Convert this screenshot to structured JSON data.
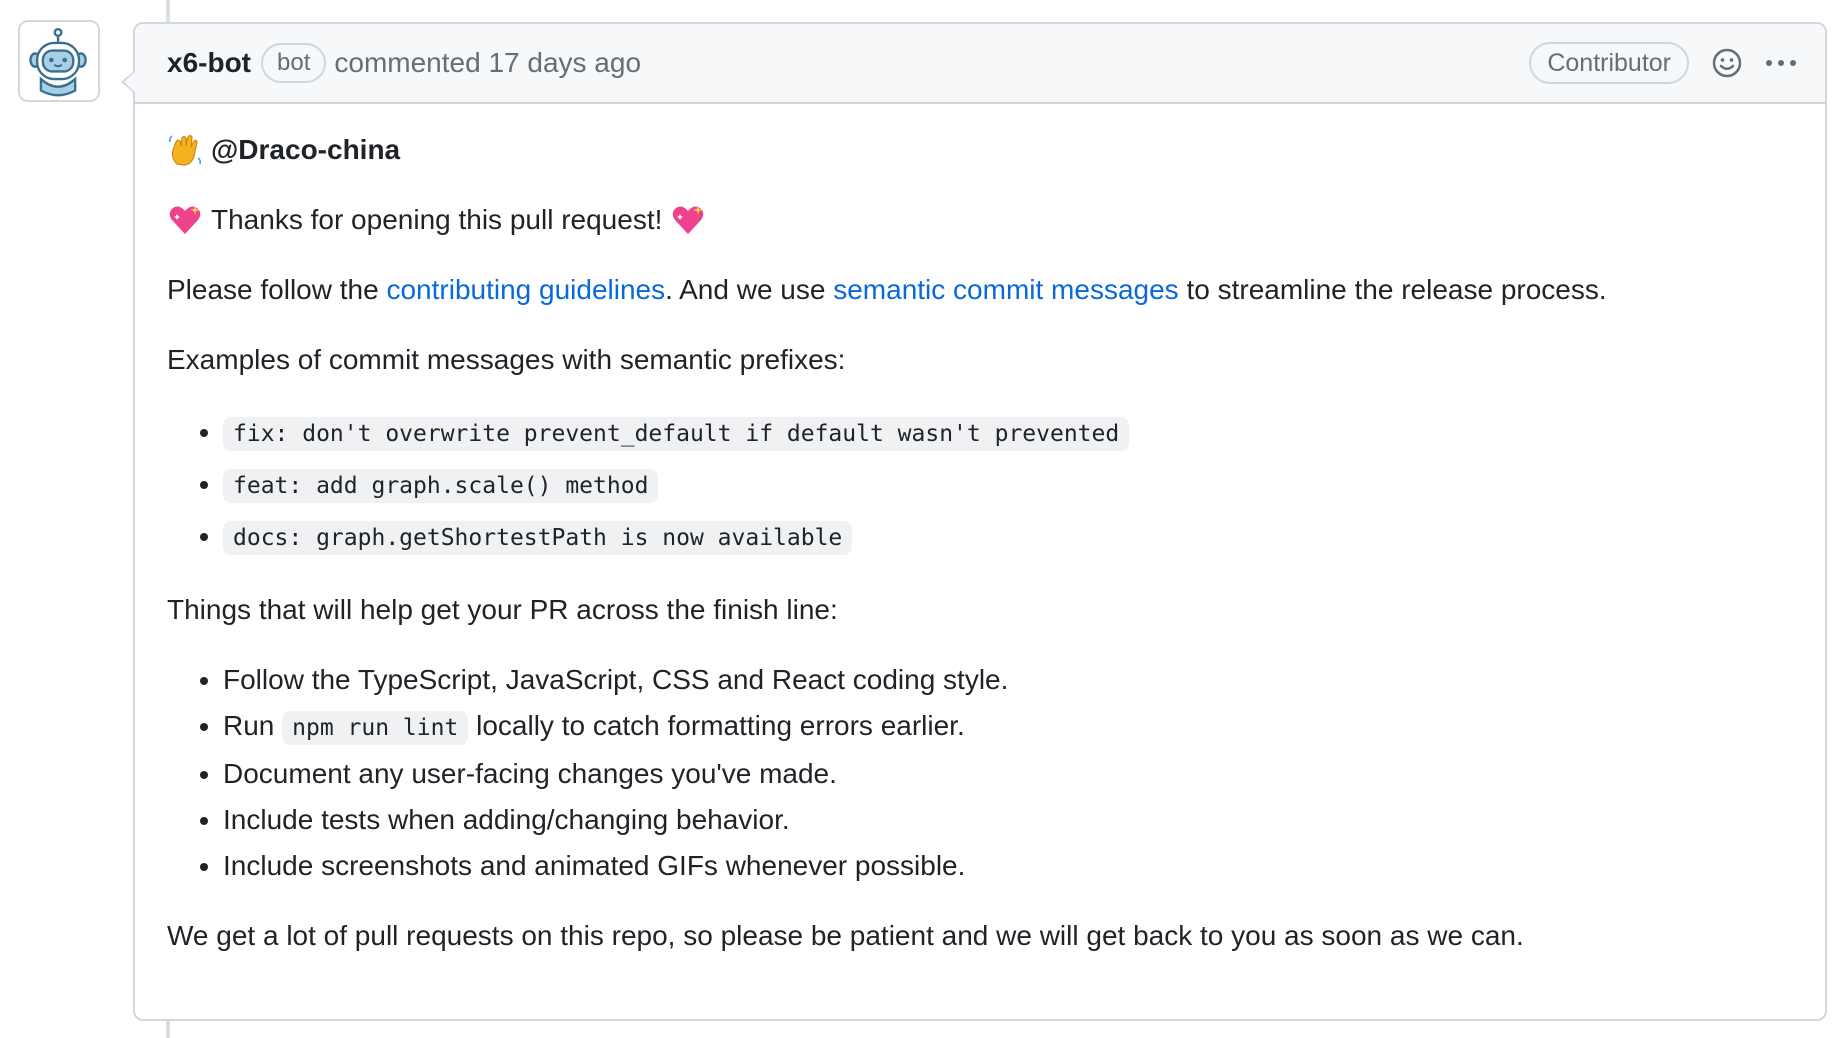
{
  "comment": {
    "author": "x6-bot",
    "author_badge": "bot",
    "action": "commented",
    "timestamp": "17 days ago",
    "role_badge": "Contributor",
    "icons": {
      "reaction": "smiley-icon",
      "menu": "kebab-menu-icon",
      "avatar": "robot-avatar"
    }
  },
  "body": {
    "greeting_mention": "@Draco-china",
    "thanks_text": "Thanks for opening this pull request!",
    "follow": {
      "prefix": "Please follow the",
      "link1": "contributing guidelines",
      "middle": ". And we use",
      "link2": "semantic commit messages",
      "suffix": "to streamline the release process."
    },
    "examples_heading": "Examples of commit messages with semantic prefixes:",
    "examples": [
      "fix: don't overwrite prevent_default if default wasn't prevented",
      "feat: add graph.scale() method",
      "docs: graph.getShortestPath is now available"
    ],
    "help_heading": "Things that will help get your PR across the finish line:",
    "help_items": {
      "item1": "Follow the TypeScript, JavaScript, CSS and React coding style.",
      "item2_prefix": "Run",
      "item2_code": "npm run lint",
      "item2_suffix": "locally to catch formatting errors earlier.",
      "item3": "Document any user-facing changes you've made.",
      "item4": "Include tests when adding/changing behavior.",
      "item5": "Include screenshots and animated GIFs whenever possible."
    },
    "closing": "We get a lot of pull requests on this repo, so please be patient and we will get back to you as soon as we can."
  },
  "colors": {
    "link": "#0969da",
    "border": "#d0d7de",
    "header_bg": "#f6f8fa",
    "muted": "#656d76"
  }
}
